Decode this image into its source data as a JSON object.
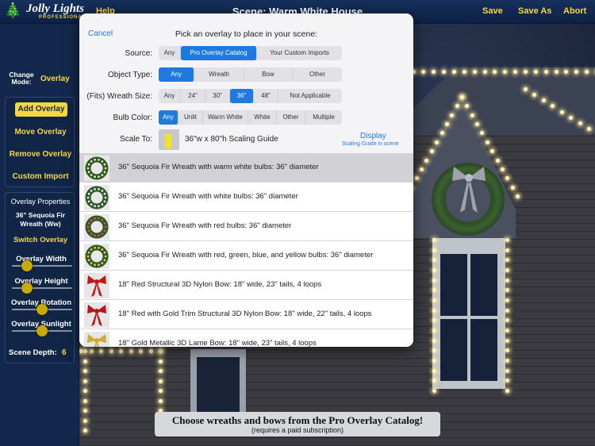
{
  "topbar": {
    "logo_name": "Jolly Lights",
    "logo_sub": "PROFESSIONAL",
    "help": "Help",
    "title": "Scene: Warm White House",
    "save": "Save",
    "save_as": "Save As",
    "abort": "Abort"
  },
  "left_panel": {
    "change_mode_label": "Change Mode:",
    "change_mode_value": "Overlay",
    "menu": [
      "Add Overlay",
      "Move Overlay",
      "Remove Overlay",
      "Custom Import"
    ],
    "properties_title": "Overlay Properties",
    "selected_overlay": "36\" Sequoia Fir Wreath (Ww)",
    "switch_overlay": "Switch Overlay",
    "sliders": [
      {
        "label": "Overlay Width",
        "level": 0.2
      },
      {
        "label": "Overlay Height",
        "level": 0.2
      },
      {
        "label": "Overlay Rotation",
        "level": 0.5
      },
      {
        "label": "Overlay Sunlight",
        "level": 0.5
      }
    ],
    "scene_depth_label": "Scene Depth:",
    "scene_depth_value": "6"
  },
  "modal": {
    "cancel": "Cancel",
    "title": "Pick an overlay to place in your scene:",
    "filters": [
      {
        "label": "Source:",
        "options": [
          "Any",
          "Pro Overlay Catalog",
          "Your Custom Imports"
        ],
        "selected": 1
      },
      {
        "label": "Object Type:",
        "options": [
          "Any",
          "Wreath",
          "Bow",
          "Other"
        ],
        "selected": 0
      },
      {
        "label": "(Fits) Wreath Size:",
        "options": [
          "Any",
          "24\"",
          "30\"",
          "36\"",
          "48\"",
          "Not Applicable"
        ],
        "selected": 3
      },
      {
        "label": "Bulb Color:",
        "options": [
          "Any",
          "Unlit",
          "Warm White",
          "White",
          "Other",
          "Multiple"
        ],
        "selected": 0
      }
    ],
    "scale_to_label": "Scale To:",
    "scale_to_value": "36\"w x 80\"h Scaling Guide",
    "display_link": "Display",
    "display_sub": "Scaling Guide in scene",
    "items": [
      {
        "label": "36\" Sequoia Fir Wreath with warm white bulbs: 36\" diameter",
        "kind": "wreath",
        "bulb_color": "#fff1b8",
        "selected": true
      },
      {
        "label": "36\" Sequoia Fir Wreath with white bulbs: 36\" diameter",
        "kind": "wreath",
        "bulb_color": "#ffffff",
        "selected": false
      },
      {
        "label": "36\" Sequoia Fir Wreath with red bulbs: 36\" diameter",
        "kind": "wreath",
        "bulb_color": "#ff4a3a",
        "selected": false
      },
      {
        "label": "36\" Sequoia Fir Wreath with red, green, blue, and yellow bulbs: 36\" diameter",
        "kind": "wreath",
        "bulb_color": "#ffd23a",
        "selected": false
      },
      {
        "label": "18\" Red Structural 3D Nylon Bow: 18\" wide, 23\" tails, 4 loops",
        "kind": "bow",
        "bow_color": "#c01818",
        "selected": false
      },
      {
        "label": "18\" Red with Gold Trim Structural 3D Nylon Bow: 18\" wide, 22\" tails, 4 loops",
        "kind": "bow",
        "bow_color": "#b81616",
        "selected": false
      },
      {
        "label": "18\" Gold Metallic 3D Lame Bow: 18\" wide, 23\" tails, 4 loops",
        "kind": "bow",
        "bow_color": "#cfa93a",
        "selected": false
      }
    ]
  },
  "banner": {
    "line1": "Choose wreaths and bows from the Pro Overlay Catalog!",
    "line2": "(requires a paid subscription)"
  }
}
